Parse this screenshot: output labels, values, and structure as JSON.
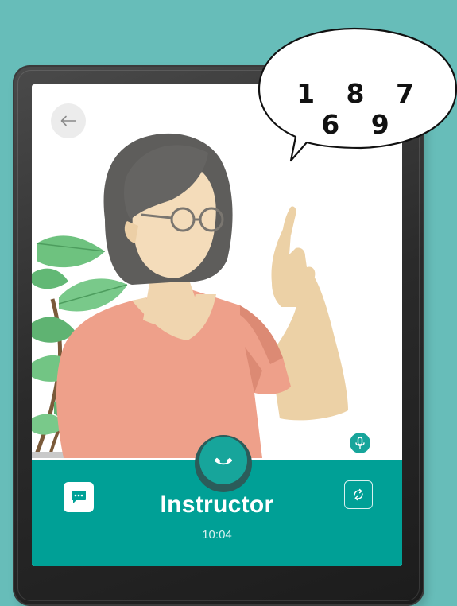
{
  "call": {
    "caller_name": "Instructor",
    "timer": "10:04"
  },
  "speech_bubble": {
    "text": "1 8 7 6 9"
  },
  "icons": {
    "back": "arrow-left-icon",
    "end_call": "phone-icon",
    "microphone": "microphone-icon",
    "chat": "chat-icon",
    "switch_camera": "switch-camera-icon"
  },
  "colors": {
    "background": "#67bdb9",
    "call_bar": "#00a096",
    "accent": "#17a59b",
    "shirt": "#eea08a",
    "skin": "#f4dcba",
    "hair": "#5e5d5b",
    "leaf": "#6ec27f"
  }
}
